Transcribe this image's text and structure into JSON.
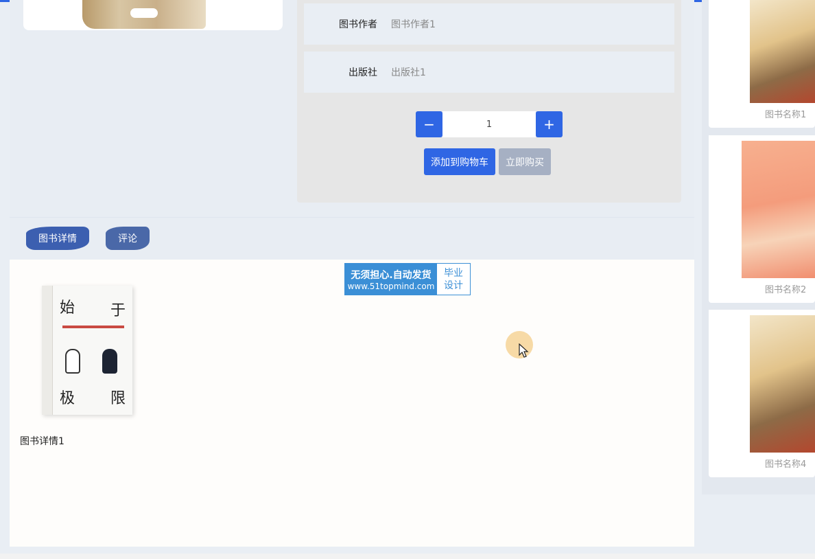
{
  "book": {
    "author_label": "图书作者",
    "author_value": "图书作者1",
    "publisher_label": "出版社",
    "publisher_value": "出版社1"
  },
  "quantity": {
    "minus": "−",
    "value": "1",
    "plus": "+"
  },
  "actions": {
    "add_to_cart": "添加到购物车",
    "buy_now": "立即购买"
  },
  "tabs": [
    {
      "label": "图书详情"
    },
    {
      "label": "评论"
    }
  ],
  "detail": {
    "caption": "图书详情1",
    "cover_chars": [
      "始",
      "于",
      "极",
      "限"
    ]
  },
  "watermark": {
    "line1": "无须担心.自动发货",
    "line2": "www.51topmind.com",
    "right1": "毕业",
    "right2": "设计"
  },
  "recommended": [
    {
      "name": "图书名称1"
    },
    {
      "name": "图书名称2"
    },
    {
      "name": "图书名称4"
    }
  ],
  "colors": {
    "primary": "#2f66e4",
    "disabled": "#a6b0c3",
    "tab": "#3c5fb0"
  }
}
